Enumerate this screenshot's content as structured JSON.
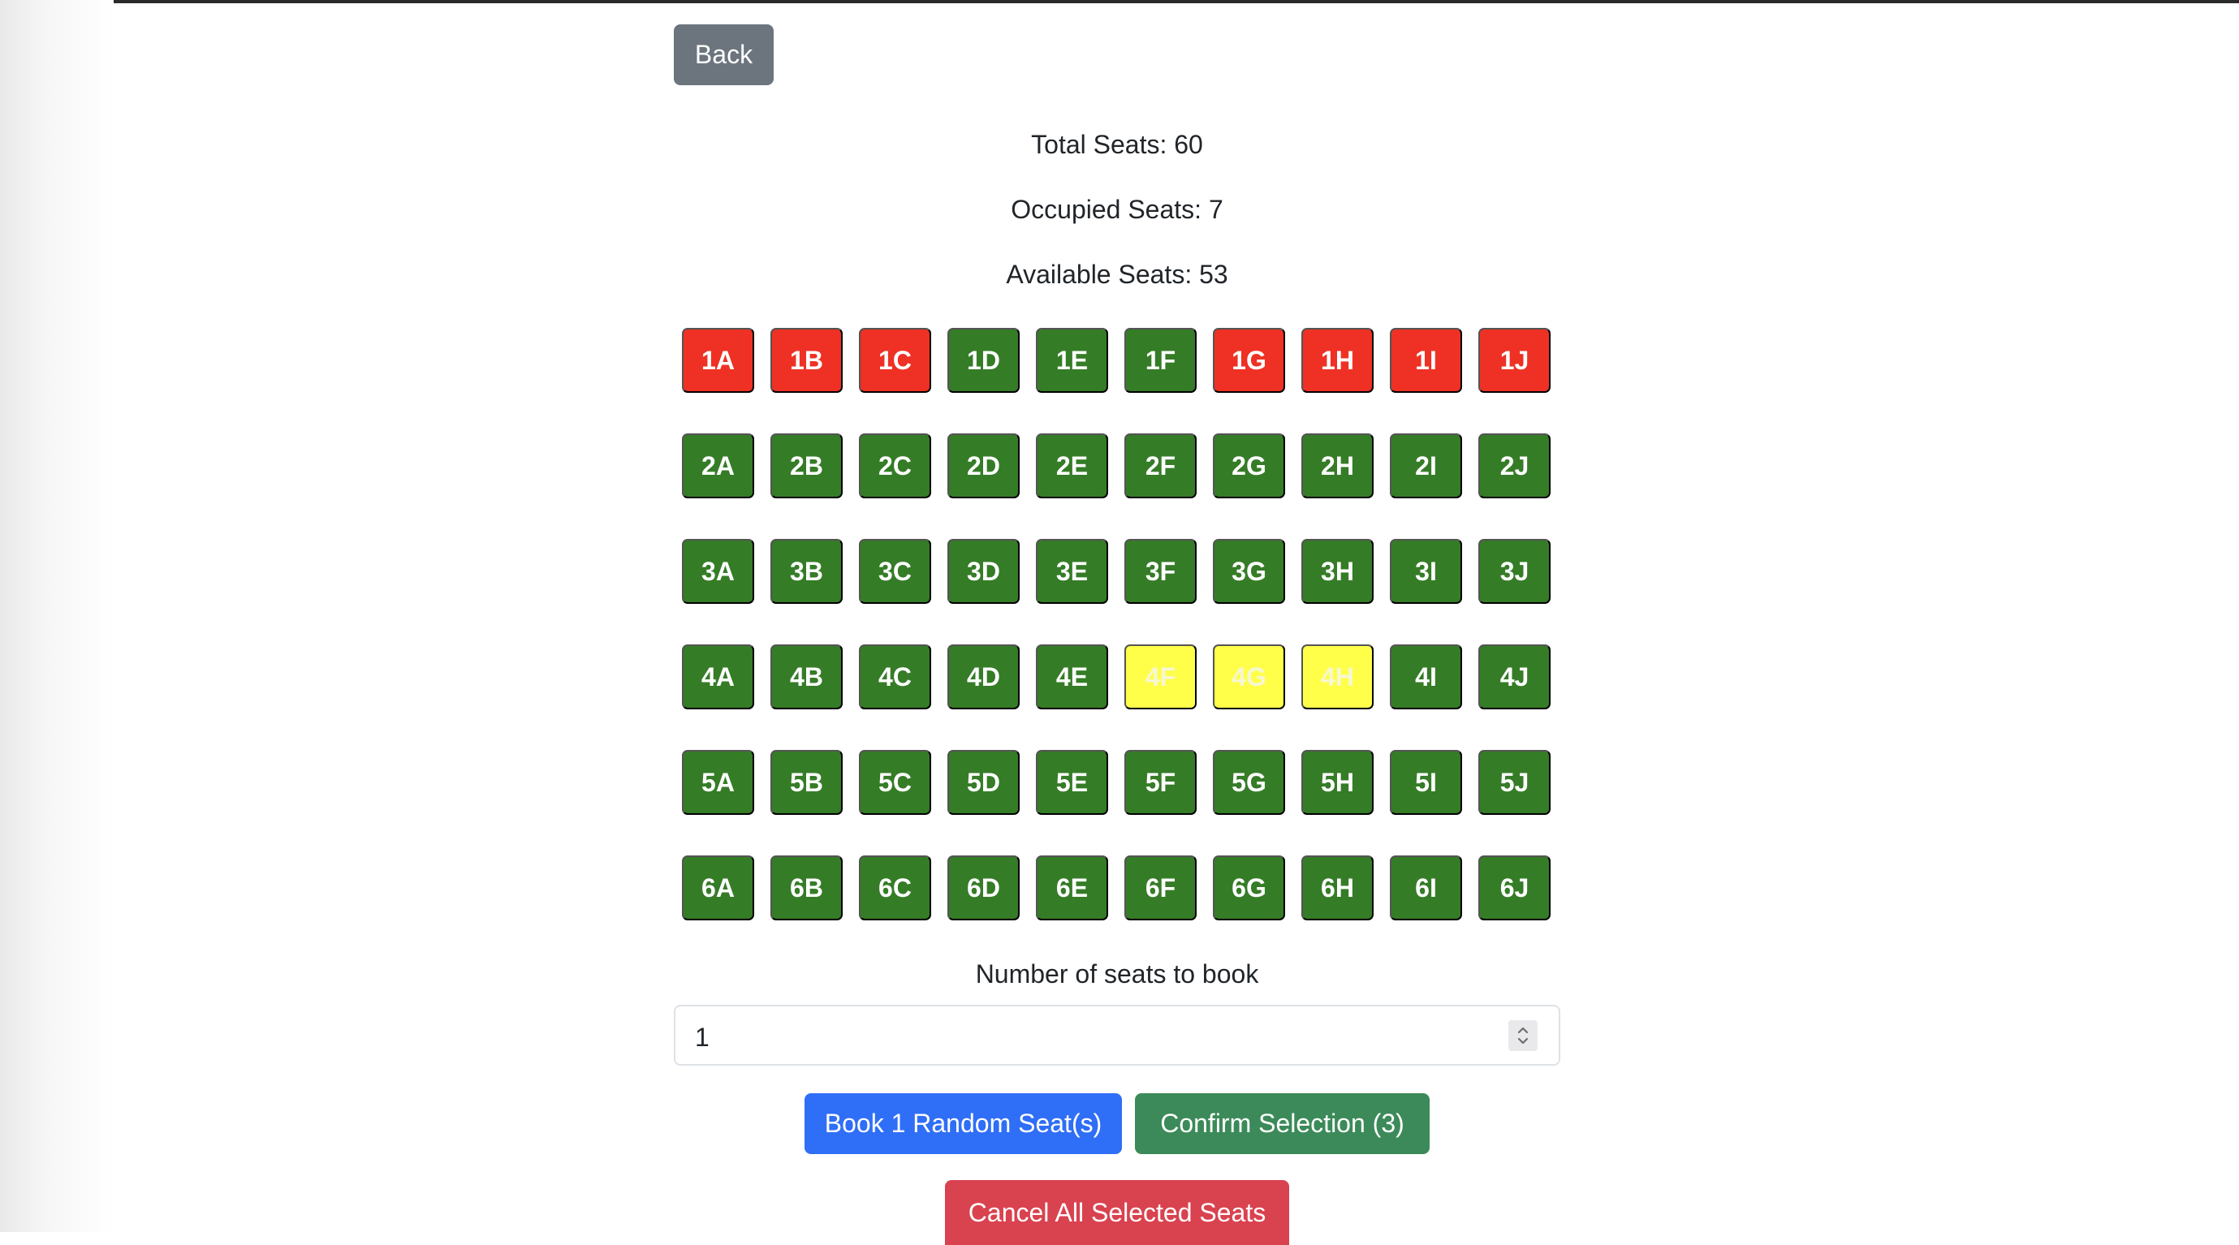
{
  "nav": {
    "back_label": "Back"
  },
  "stats": {
    "total": "Total Seats: 60",
    "occupied": "Occupied Seats: 7",
    "available": "Available Seats: 53"
  },
  "colors": {
    "available": "#357c27",
    "occupied": "#ee3124",
    "selected": "#ffff4a",
    "primary": "#2f6ef6",
    "success": "#3c8a59",
    "danger": "#d9424f",
    "secondary": "#6c757d"
  },
  "seat_rows": [
    [
      {
        "label": "1A",
        "status": "occupied"
      },
      {
        "label": "1B",
        "status": "occupied"
      },
      {
        "label": "1C",
        "status": "occupied"
      },
      {
        "label": "1D",
        "status": "available"
      },
      {
        "label": "1E",
        "status": "available"
      },
      {
        "label": "1F",
        "status": "available"
      },
      {
        "label": "1G",
        "status": "occupied"
      },
      {
        "label": "1H",
        "status": "occupied"
      },
      {
        "label": "1I",
        "status": "occupied"
      },
      {
        "label": "1J",
        "status": "occupied"
      }
    ],
    [
      {
        "label": "2A",
        "status": "available"
      },
      {
        "label": "2B",
        "status": "available"
      },
      {
        "label": "2C",
        "status": "available"
      },
      {
        "label": "2D",
        "status": "available"
      },
      {
        "label": "2E",
        "status": "available"
      },
      {
        "label": "2F",
        "status": "available"
      },
      {
        "label": "2G",
        "status": "available"
      },
      {
        "label": "2H",
        "status": "available"
      },
      {
        "label": "2I",
        "status": "available"
      },
      {
        "label": "2J",
        "status": "available"
      }
    ],
    [
      {
        "label": "3A",
        "status": "available"
      },
      {
        "label": "3B",
        "status": "available"
      },
      {
        "label": "3C",
        "status": "available"
      },
      {
        "label": "3D",
        "status": "available"
      },
      {
        "label": "3E",
        "status": "available"
      },
      {
        "label": "3F",
        "status": "available"
      },
      {
        "label": "3G",
        "status": "available"
      },
      {
        "label": "3H",
        "status": "available"
      },
      {
        "label": "3I",
        "status": "available"
      },
      {
        "label": "3J",
        "status": "available"
      }
    ],
    [
      {
        "label": "4A",
        "status": "available"
      },
      {
        "label": "4B",
        "status": "available"
      },
      {
        "label": "4C",
        "status": "available"
      },
      {
        "label": "4D",
        "status": "available"
      },
      {
        "label": "4E",
        "status": "available"
      },
      {
        "label": "4F",
        "status": "selected"
      },
      {
        "label": "4G",
        "status": "selected"
      },
      {
        "label": "4H",
        "status": "selected"
      },
      {
        "label": "4I",
        "status": "available"
      },
      {
        "label": "4J",
        "status": "available"
      }
    ],
    [
      {
        "label": "5A",
        "status": "available"
      },
      {
        "label": "5B",
        "status": "available"
      },
      {
        "label": "5C",
        "status": "available"
      },
      {
        "label": "5D",
        "status": "available"
      },
      {
        "label": "5E",
        "status": "available"
      },
      {
        "label": "5F",
        "status": "available"
      },
      {
        "label": "5G",
        "status": "available"
      },
      {
        "label": "5H",
        "status": "available"
      },
      {
        "label": "5I",
        "status": "available"
      },
      {
        "label": "5J",
        "status": "available"
      }
    ],
    [
      {
        "label": "6A",
        "status": "available"
      },
      {
        "label": "6B",
        "status": "available"
      },
      {
        "label": "6C",
        "status": "available"
      },
      {
        "label": "6D",
        "status": "available"
      },
      {
        "label": "6E",
        "status": "available"
      },
      {
        "label": "6F",
        "status": "available"
      },
      {
        "label": "6G",
        "status": "available"
      },
      {
        "label": "6H",
        "status": "available"
      },
      {
        "label": "6I",
        "status": "available"
      },
      {
        "label": "6J",
        "status": "available"
      }
    ]
  ],
  "booking": {
    "count_label": "Number of seats to book",
    "count_value": "1",
    "stepper_icon": "updown-chevron-icon",
    "random_button_label": "Book 1 Random Seat(s)",
    "confirm_button_label": "Confirm Selection (3)",
    "cancel_button_label": "Cancel All Selected Seats"
  }
}
